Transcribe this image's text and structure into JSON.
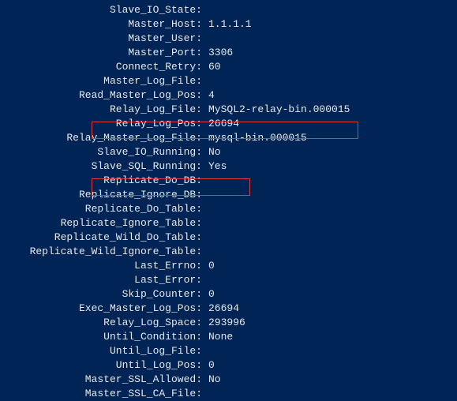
{
  "rows": [
    {
      "label": "Slave_IO_State:",
      "value": ""
    },
    {
      "label": "Master_Host:",
      "value": "1.1.1.1"
    },
    {
      "label": "Master_User:",
      "value": ""
    },
    {
      "label": "Master_Port:",
      "value": "3306"
    },
    {
      "label": "Connect_Retry:",
      "value": "60"
    },
    {
      "label": "Master_Log_File:",
      "value": ""
    },
    {
      "label": "Read_Master_Log_Pos:",
      "value": "4"
    },
    {
      "label": "Relay_Log_File:",
      "value": "MySQL2-relay-bin.000015"
    },
    {
      "label": "Relay_Log_Pos:",
      "value": "26694"
    },
    {
      "label": "Relay_Master_Log_File:",
      "value": "mysql-bin.000015"
    },
    {
      "label": "Slave_IO_Running:",
      "value": "No"
    },
    {
      "label": "Slave_SQL_Running:",
      "value": "Yes"
    },
    {
      "label": "Replicate_Do_DB:",
      "value": ""
    },
    {
      "label": "Replicate_Ignore_DB:",
      "value": ""
    },
    {
      "label": "Replicate_Do_Table:",
      "value": ""
    },
    {
      "label": "Replicate_Ignore_Table:",
      "value": ""
    },
    {
      "label": "Replicate_Wild_Do_Table:",
      "value": ""
    },
    {
      "label": "Replicate_Wild_Ignore_Table:",
      "value": ""
    },
    {
      "label": "Last_Errno:",
      "value": "0"
    },
    {
      "label": "Last_Error:",
      "value": ""
    },
    {
      "label": "Skip_Counter:",
      "value": "0"
    },
    {
      "label": "Exec_Master_Log_Pos:",
      "value": "26694"
    },
    {
      "label": "Relay_Log_Space:",
      "value": "293996"
    },
    {
      "label": "Until_Condition:",
      "value": "None"
    },
    {
      "label": "Until_Log_File:",
      "value": ""
    },
    {
      "label": "Until_Log_Pos:",
      "value": "0"
    },
    {
      "label": "Master_SSL_Allowed:",
      "value": "No"
    },
    {
      "label": "Master_SSL_CA_File:",
      "value": ""
    }
  ],
  "highlights": {
    "box1_row_index": 7,
    "box2_row_index": 11
  }
}
